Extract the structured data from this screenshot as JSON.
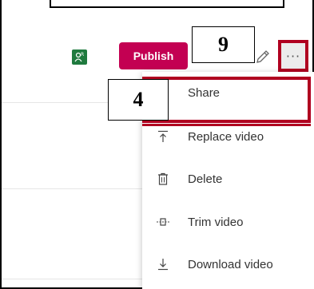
{
  "toolbar": {
    "publish_label": "Publish",
    "more_label": "···"
  },
  "callouts": {
    "nine": "9",
    "four": "4"
  },
  "menu": {
    "items": [
      {
        "label": "Share",
        "icon": "share-icon"
      },
      {
        "label": "Replace video",
        "icon": "upload-icon"
      },
      {
        "label": "Delete",
        "icon": "trash-icon"
      },
      {
        "label": "Trim video",
        "icon": "trim-icon"
      },
      {
        "label": "Download video",
        "icon": "download-icon"
      }
    ]
  },
  "colors": {
    "publish": "#c30052",
    "highlight": "#b00020",
    "collab": "#1f7a3e"
  }
}
